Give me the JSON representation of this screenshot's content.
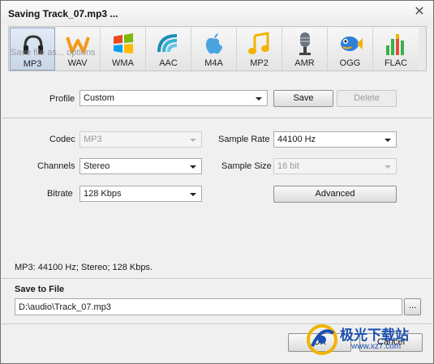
{
  "window": {
    "title": "Saving Track_07.mp3 ..."
  },
  "formats": [
    {
      "label": "MP3",
      "icon": "headphones-icon",
      "selected": true
    },
    {
      "label": "WAV",
      "icon": "waveform-w-icon",
      "selected": false
    },
    {
      "label": "WMA",
      "icon": "windows-flag-icon",
      "selected": false
    },
    {
      "label": "AAC",
      "icon": "aac-wave-icon",
      "selected": false
    },
    {
      "label": "M4A",
      "icon": "apple-icon",
      "selected": false
    },
    {
      "label": "MP2",
      "icon": "music-note-icon",
      "selected": false
    },
    {
      "label": "AMR",
      "icon": "microphone-icon",
      "selected": false
    },
    {
      "label": "OGG",
      "icon": "fish-icon",
      "selected": false
    },
    {
      "label": "FLAC",
      "icon": "equalizer-bars-icon",
      "selected": false
    }
  ],
  "ghost_text": "Save file as... options",
  "profile": {
    "label": "Profile",
    "value": "Custom",
    "save_label": "Save",
    "delete_label": "Delete"
  },
  "settings": {
    "codec_label": "Codec",
    "codec_value": "MP3",
    "channels_label": "Channels",
    "channels_value": "Stereo",
    "bitrate_label": "Bitrate",
    "bitrate_value": "128 Kbps",
    "sample_rate_label": "Sample Rate",
    "sample_rate_value": "44100 Hz",
    "sample_size_label": "Sample Size",
    "sample_size_value": "16 bit",
    "advanced_label": "Advanced"
  },
  "summary": "MP3: 44100  Hz; Stereo; 128 Kbps.",
  "save_to_file": {
    "title": "Save to File",
    "path": "D:\\audio\\Track_07.mp3",
    "browse_label": "..."
  },
  "footer": {
    "ok_label": "OK",
    "cancel_label": "Cancel"
  },
  "watermark": {
    "line1": "极光下载站",
    "line2": "www.xz7.com"
  },
  "colors": {
    "accent_selected": "#c8d6e7",
    "watermark": "#1a4fae"
  }
}
